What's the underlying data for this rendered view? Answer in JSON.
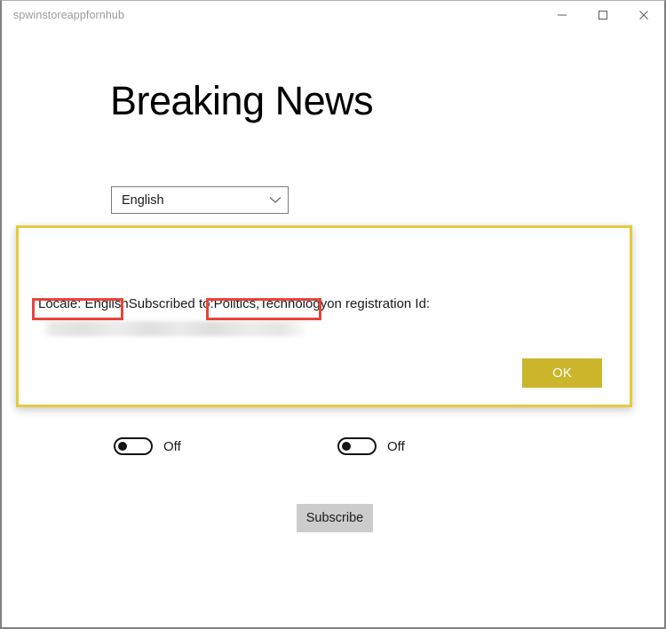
{
  "window": {
    "title": "spwinstoreappfornhub",
    "controls": [
      {
        "name": "minimize",
        "label": "—"
      },
      {
        "name": "maximize",
        "label": "□"
      },
      {
        "name": "close",
        "label": "✕"
      }
    ]
  },
  "page": {
    "heading": "Breaking News"
  },
  "locale_select": {
    "value": "English",
    "icon": "chevron-down-icon"
  },
  "toggles": [
    {
      "name": "topic-toggle-1",
      "state_label": "Off",
      "checked": false
    },
    {
      "name": "topic-toggle-2",
      "state_label": "Off",
      "checked": false
    }
  ],
  "actions": {
    "subscribe_label": "Subscribe"
  },
  "dialog": {
    "message_parts": {
      "locale": "Locale: English",
      "subscribed_to_label": " Subscribed to: ",
      "topics": "Politics,Technology",
      "registration_tail": " on registration Id:"
    },
    "registration_id": "",
    "ok_label": "OK"
  },
  "colors": {
    "dialog_border": "#e3cb3e",
    "ok_button": "#cbb62b",
    "annotation": "#e8433a",
    "subscribe_button": "#cccccc",
    "window_border": "#808080",
    "title_text": "#9a9a9a"
  }
}
